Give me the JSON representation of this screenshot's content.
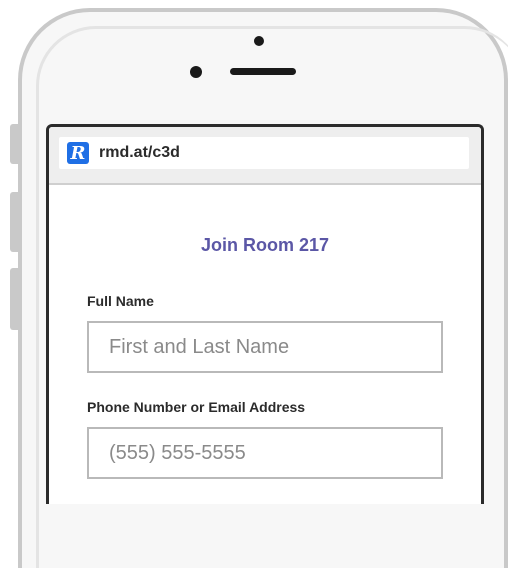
{
  "browser": {
    "logo_letter": "R",
    "url": "rmd.at/c3d"
  },
  "form": {
    "title": "Join Room 217",
    "name_label": "Full Name",
    "name_placeholder": "First and Last Name",
    "contact_label": "Phone Number or Email Address",
    "contact_placeholder": "(555) 555-5555"
  },
  "colors": {
    "accent": "#5b57a6",
    "logo": "#1f6fe5"
  }
}
